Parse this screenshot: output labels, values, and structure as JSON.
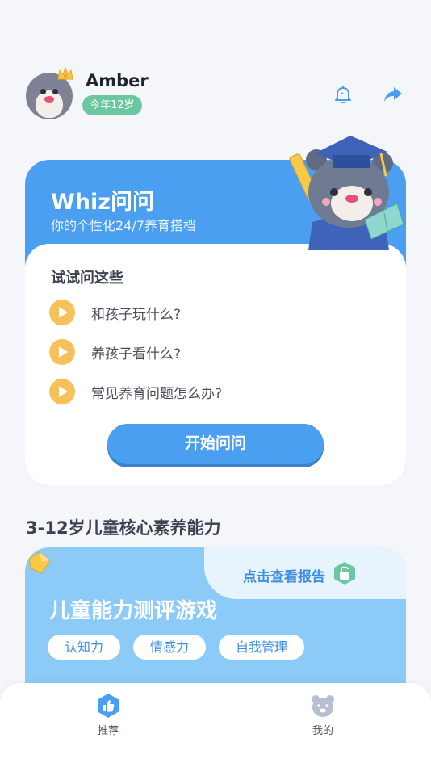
{
  "header": {
    "username": "Amber",
    "age_badge": "今年12岁",
    "icons": [
      "bell-icon",
      "share-icon"
    ]
  },
  "whiz": {
    "title": "Whiz问问",
    "subtitle": "你的个性化24/7养育搭档",
    "try_title": "试试问这些",
    "questions": [
      {
        "text": "和孩子玩什么?"
      },
      {
        "text": "养孩子看什么?"
      },
      {
        "text": "常见养育问题怎么办?"
      }
    ],
    "start_button": "开始问问"
  },
  "abilities": {
    "section_title": "3-12岁儿童核心素养能力",
    "report_link": "点击查看报告",
    "game_title": "儿童能力测评游戏",
    "tags": [
      "认知力",
      "情感力",
      "自我管理"
    ]
  },
  "bottom_nav": {
    "items": [
      {
        "label": "推荐",
        "icon": "thumbs-up-icon"
      },
      {
        "label": "我的",
        "icon": "bear-face-icon"
      }
    ]
  },
  "colors": {
    "primary_blue": "#4a9ff0",
    "light_blue": "#8ccaf7",
    "play_yellow": "#f6c15a",
    "badge_green": "#6bc7a0",
    "background": "#f5f6fa"
  }
}
